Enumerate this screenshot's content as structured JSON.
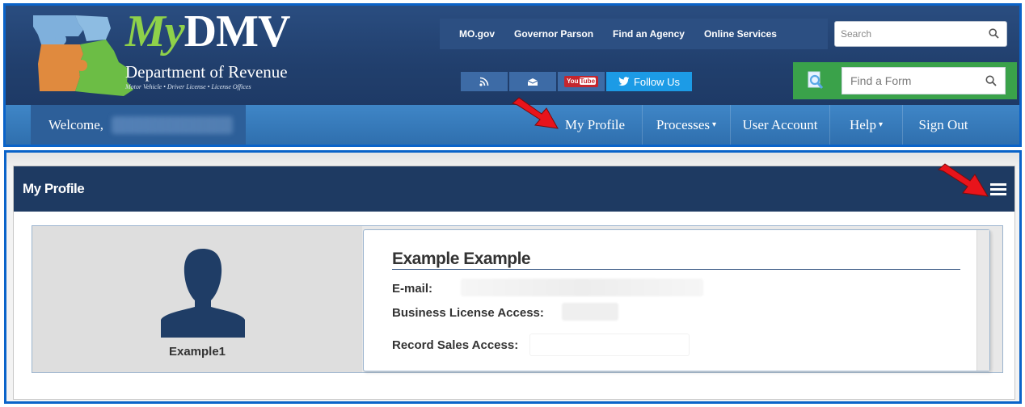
{
  "header": {
    "brand_my": "My",
    "brand_dmv": "DMV",
    "department": "Department of Revenue",
    "subtitle": "Motor Vehicle  •  Driver License  •  License Offices",
    "top_links": [
      "MO.gov",
      "Governor Parson",
      "Find an Agency",
      "Online Services"
    ],
    "search_placeholder": "Search",
    "social": {
      "youtube_a": "You",
      "youtube_b": "Tube",
      "follow_label": "Follow Us"
    },
    "form_search_placeholder": "Find a Form"
  },
  "navbar": {
    "welcome": "Welcome,",
    "items": {
      "my_profile": "My Profile",
      "processes": "Processes",
      "user_account": "User Account",
      "help": "Help",
      "sign_out": "Sign Out"
    }
  },
  "profile": {
    "title": "My Profile",
    "username": "Example1",
    "full_name": "Example Example",
    "email_label": "E-mail:",
    "business_license_label": "Business License Access:",
    "record_sales_label": "Record Sales Access:"
  },
  "colors": {
    "header_navy": "#213f6d",
    "nav_blue": "#3577b9",
    "panel_navy": "#1e3a62",
    "brand_green": "#8fd14a",
    "form_green": "#3aa24a",
    "follow_blue": "#1c9be6",
    "frame_blue": "#0a63c9",
    "arrow_red": "#e8141b"
  },
  "icons": [
    "missouri-puzzle-map-icon",
    "search-icon",
    "rss-icon",
    "envelope-icon",
    "youtube-icon",
    "twitter-icon",
    "form-search-icon",
    "caret-down-icon",
    "hamburger-menu-icon",
    "user-silhouette-icon",
    "red-arrow-icon"
  ]
}
